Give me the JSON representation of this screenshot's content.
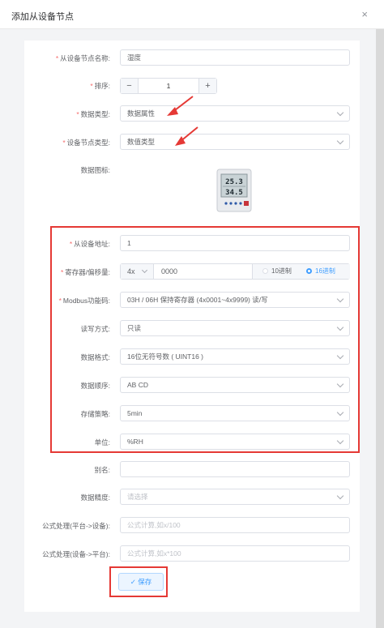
{
  "dialog": {
    "title": "添加从设备节点",
    "close_symbol": "×"
  },
  "form": {
    "name": {
      "label": "从设备节点名称:",
      "value": "湿度"
    },
    "order": {
      "label": "排序:",
      "value": "1",
      "minus": "−",
      "plus": "+"
    },
    "data_type": {
      "label": "数据类型:",
      "value": "数据属性"
    },
    "node_type": {
      "label": "设备节点类型:",
      "value": "数值类型"
    },
    "icon": {
      "label": "数据图标:"
    },
    "slave_address": {
      "label": "从设备地址:",
      "value": "1"
    },
    "register": {
      "label": "寄存器/偏移量:",
      "prefix": "4x",
      "value": "0000",
      "options": [
        "10进制",
        "16进制"
      ],
      "selected": "16进制"
    },
    "modbus_code": {
      "label": "Modbus功能码:",
      "value": "03H / 06H 保持寄存器 (4x0001~4x9999) 读/写"
    },
    "rw_mode": {
      "label": "读写方式:",
      "value": "只读"
    },
    "data_format": {
      "label": "数据格式:",
      "value": "16位无符号数 ( UINT16 )"
    },
    "byte_order": {
      "label": "数据顺序:",
      "value": "AB CD"
    },
    "storage": {
      "label": "存储策略:",
      "value": "5min"
    },
    "unit": {
      "label": "单位:",
      "value": "%RH"
    },
    "alias": {
      "label": "别名:",
      "value": ""
    },
    "precision": {
      "label": "数据精度:",
      "placeholder": "请选择"
    },
    "formula_up": {
      "label": "公式处理(平台->设备):",
      "placeholder": "公式计算,如x/100"
    },
    "formula_down": {
      "label": "公式处理(设备->平台):",
      "placeholder": "公式计算,如x*100"
    }
  },
  "device_display": {
    "top": "25.3",
    "bottom": "34.5"
  },
  "save_button": {
    "label": "保存",
    "icon": "check-icon"
  },
  "colors": {
    "accent": "#409eff",
    "annotation": "#e53935",
    "required": "#f56c6c"
  }
}
